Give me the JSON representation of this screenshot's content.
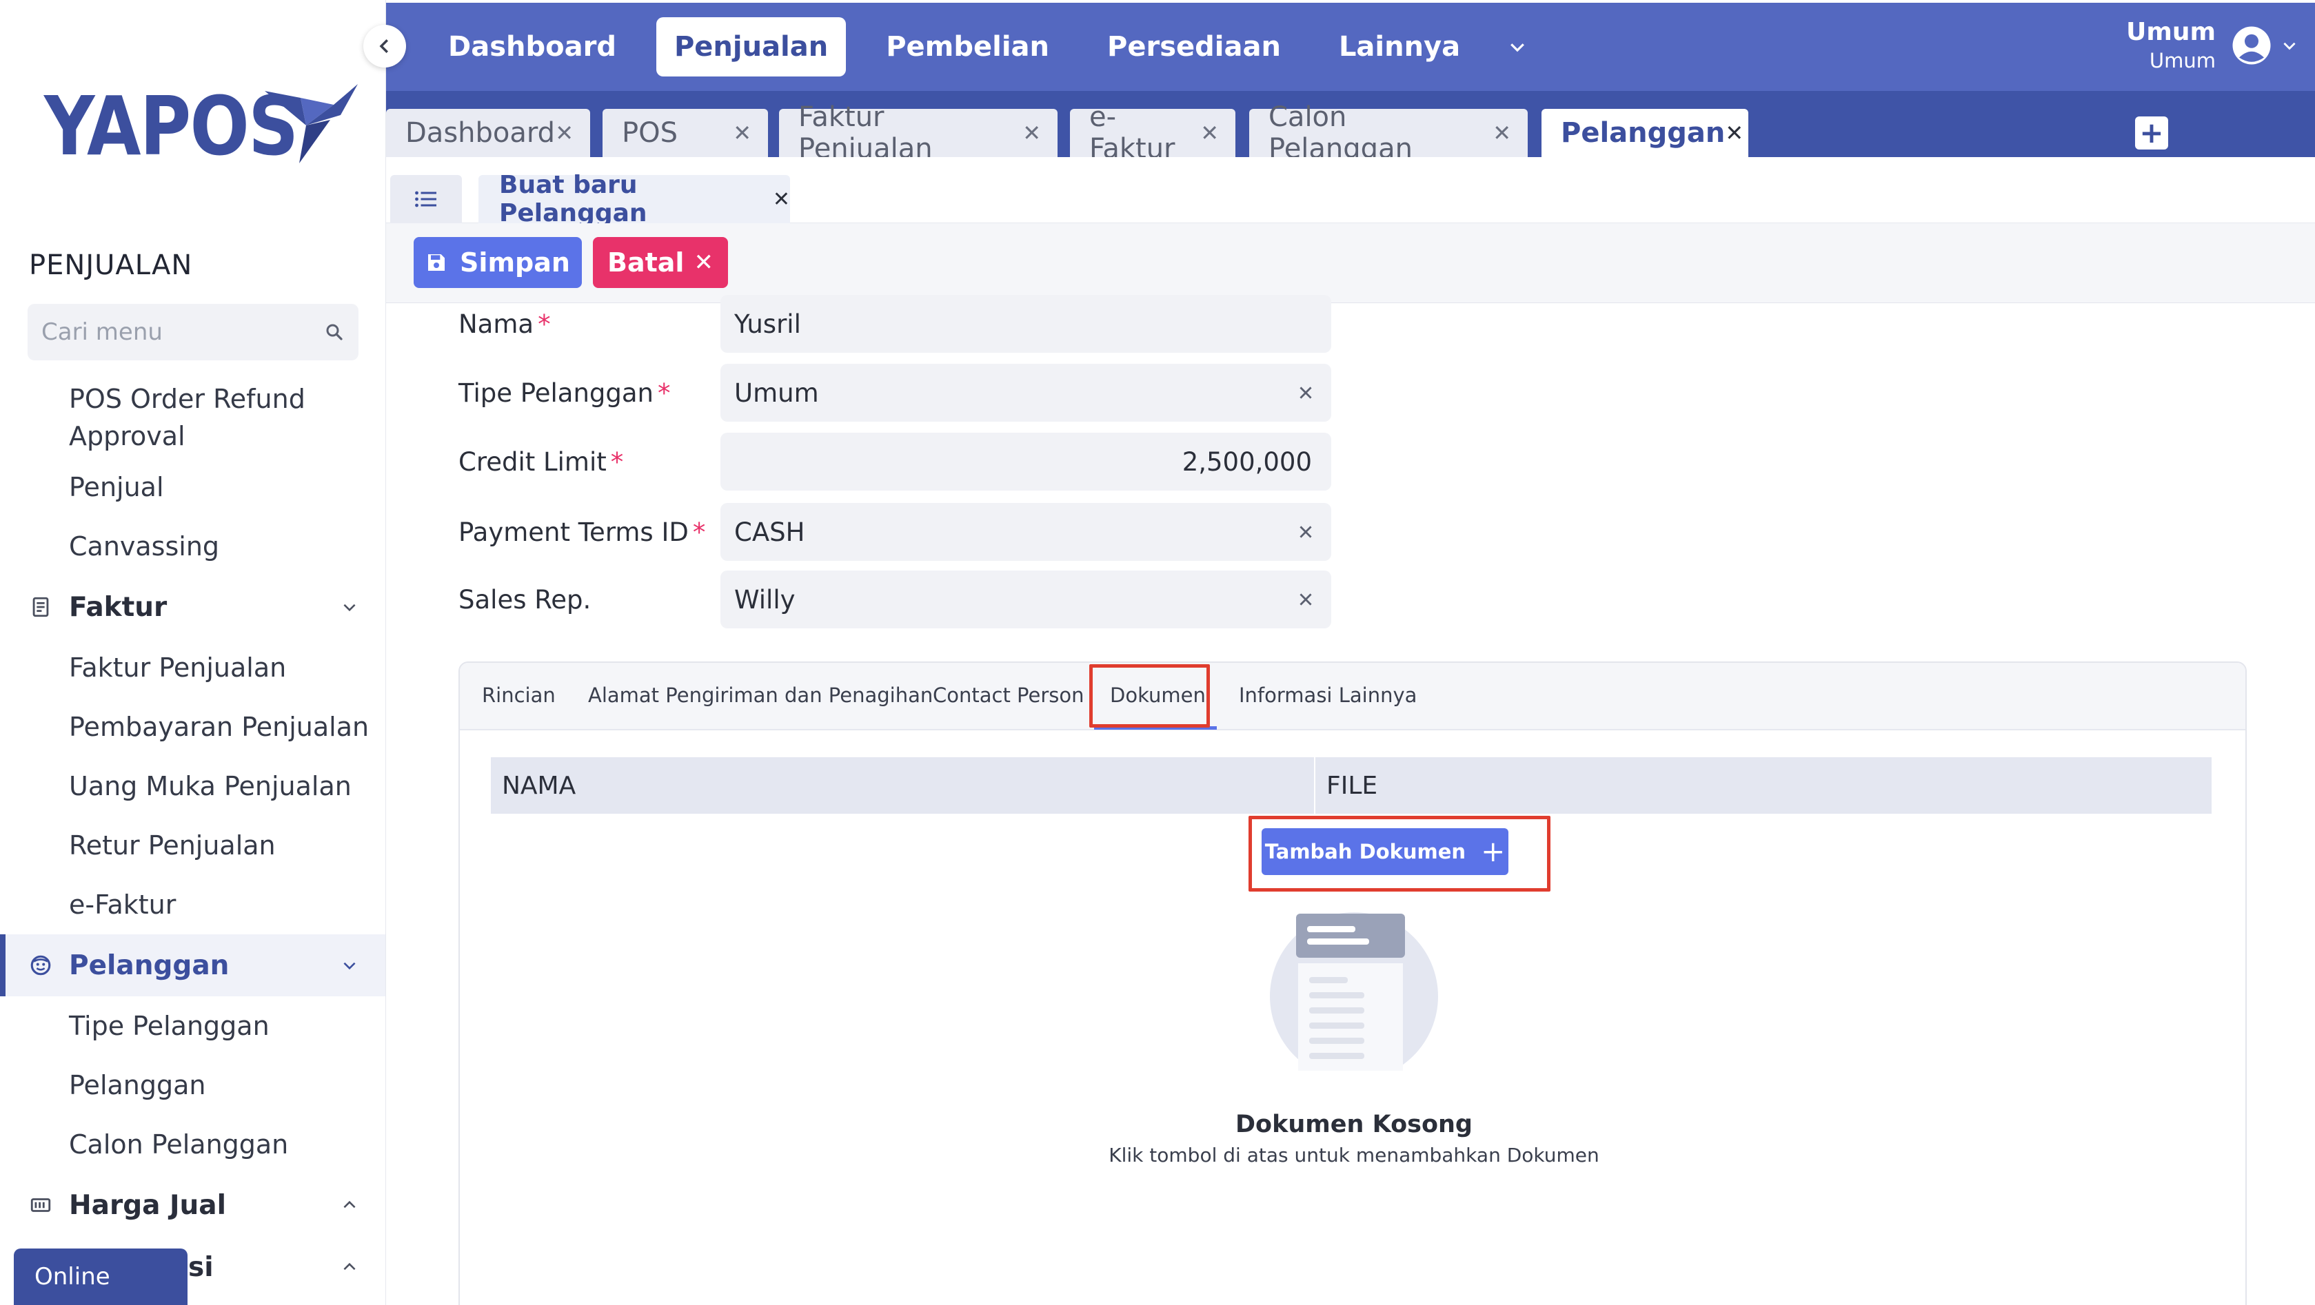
{
  "brand": {
    "name": "YAPOS",
    "color": "#3c4f9e"
  },
  "sidebar": {
    "section_title": "PENJUALAN",
    "search_placeholder": "Cari menu",
    "items": [
      {
        "type": "sub",
        "label": "POS Order Refund Approval"
      },
      {
        "type": "sub",
        "label": "Penjual"
      },
      {
        "type": "sub",
        "label": "Canvassing"
      },
      {
        "type": "group",
        "label": "Faktur",
        "icon": "receipt-icon",
        "expanded": true
      },
      {
        "type": "sub",
        "label": "Faktur Penjualan"
      },
      {
        "type": "sub",
        "label": "Pembayaran Penjualan"
      },
      {
        "type": "sub",
        "label": "Uang Muka Penjualan"
      },
      {
        "type": "sub",
        "label": "Retur Penjualan"
      },
      {
        "type": "sub",
        "label": "e-Faktur"
      },
      {
        "type": "group",
        "label": "Pelanggan",
        "icon": "face-icon",
        "expanded": true,
        "active": true
      },
      {
        "type": "sub",
        "label": "Tipe Pelanggan"
      },
      {
        "type": "sub",
        "label": "Pelanggan"
      },
      {
        "type": "sub",
        "label": "Calon Pelanggan"
      },
      {
        "type": "group",
        "label": "Harga Jual",
        "icon": "price-tag-icon",
        "expanded": false
      },
      {
        "type": "group",
        "label": "n Garansi",
        "icon": "warranty-icon",
        "expanded": false
      }
    ],
    "status_badge": "Online"
  },
  "topnav": {
    "items": [
      {
        "label": "Dashboard",
        "active": false
      },
      {
        "label": "Penjualan",
        "active": true
      },
      {
        "label": "Pembelian",
        "active": false
      },
      {
        "label": "Persediaan",
        "active": false
      },
      {
        "label": "Lainnya",
        "active": false
      }
    ],
    "user": {
      "name": "Umum",
      "role": "Umum"
    }
  },
  "doc_tabs": [
    {
      "label": "Dashboard",
      "active": false
    },
    {
      "label": "POS",
      "active": false
    },
    {
      "label": "Faktur Penjualan",
      "active": false
    },
    {
      "label": "e-Faktur",
      "active": false
    },
    {
      "label": "Calon Pelanggan",
      "active": false
    },
    {
      "label": "Pelanggan",
      "active": true
    }
  ],
  "sub_tab": {
    "label": "Buat baru Pelanggan"
  },
  "actions": {
    "save_label": "Simpan",
    "cancel_label": "Batal"
  },
  "form": {
    "fields": [
      {
        "label": "Nama",
        "required": true,
        "value": "Yusril",
        "clearable": false,
        "numeric": false
      },
      {
        "label": "Tipe Pelanggan",
        "required": true,
        "value": "Umum",
        "clearable": true,
        "numeric": false
      },
      {
        "label": "Credit Limit",
        "required": true,
        "value": "2,500,000",
        "clearable": false,
        "numeric": true
      },
      {
        "label": "Payment Terms ID",
        "required": true,
        "value": "CASH",
        "clearable": true,
        "numeric": false
      },
      {
        "label": "Sales Rep.",
        "required": false,
        "value": "Willy",
        "clearable": true,
        "numeric": false
      }
    ]
  },
  "detail_tabs": [
    {
      "label": "Rincian",
      "active": false
    },
    {
      "label": "Alamat Pengiriman dan Penagihan",
      "active": false
    },
    {
      "label": "Contact Person",
      "active": false
    },
    {
      "label": "Dokumen",
      "active": true
    },
    {
      "label": "Informasi Lainnya",
      "active": false
    }
  ],
  "documents": {
    "columns": [
      "NAMA",
      "FILE"
    ],
    "add_button": "Tambah Dokumen",
    "empty_title": "Dokumen Kosong",
    "empty_subtitle": "Klik tombol di atas untuk menambahkan Dokumen"
  },
  "colors": {
    "nav_bg": "#5468c0",
    "tabbar_bg": "#3f54a7",
    "primary": "#5b73e8",
    "danger": "#e8326a",
    "highlight_box": "#e03d2f"
  }
}
